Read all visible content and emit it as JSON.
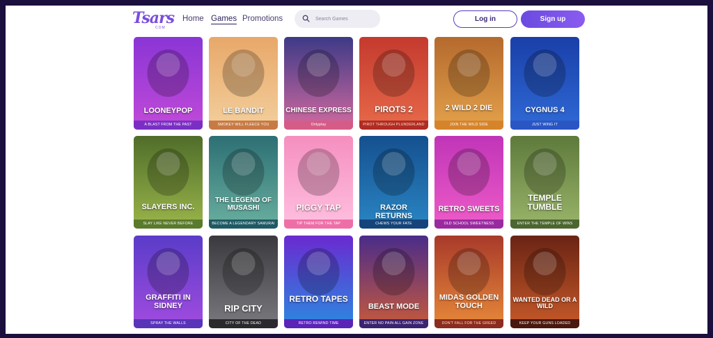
{
  "header": {
    "logo_text": "Tsars",
    "logo_sub": "COM",
    "nav": [
      {
        "label": "Home"
      },
      {
        "label": "Games"
      },
      {
        "label": "Promotions"
      }
    ],
    "search_placeholder": "Search Games",
    "login_label": "Log in",
    "signup_label": "Sign up"
  },
  "colors": {
    "accent": "#6a4ae0",
    "page_bg": "#1b0f3d"
  },
  "games": [
    {
      "title": "LOONEYPOP",
      "tagline": "A BLAST FROM THE PAST",
      "bg": "#8a35d6",
      "bg2": "#c24ad8",
      "tag_bg": "#7a2fc4",
      "tag_color": "#ffffff"
    },
    {
      "title": "LE BANDIT",
      "tagline": "SMOKEY WILL FLEECE YOU",
      "bg": "#e8a86a",
      "bg2": "#f3cf9c",
      "tag_bg": "#c87a45",
      "tag_color": "#ffffff"
    },
    {
      "title": "CHINESE EXPRESS",
      "tagline": "Onlyplay",
      "bg": "#3d3a86",
      "bg2": "#d36aa0",
      "tag_bg": "#d55c86",
      "tag_color": "#ffffff"
    },
    {
      "title": "PIROTS 2",
      "tagline": "PIROT THROUGH PLUNDERLAND",
      "bg": "#c43a2e",
      "bg2": "#e86a4a",
      "tag_bg": "#b02c24",
      "tag_color": "#ffe0c8"
    },
    {
      "title": "2 WILD 2 DIE",
      "tagline": "JOIN THE WILD SIDE",
      "bg": "#b56a2e",
      "bg2": "#e4a24a",
      "tag_bg": "#d6842c",
      "tag_color": "#ffffff"
    },
    {
      "title": "CYGNUS 4",
      "tagline": "JUST WING IT",
      "bg": "#1a3fa8",
      "bg2": "#2f6ad6",
      "tag_bg": "#2a56c4",
      "tag_color": "#ffffff"
    },
    {
      "title": "SLAYERS INC.",
      "tagline": "SLAY LIKE NEVER BEFORE",
      "bg": "#4f6d2a",
      "bg2": "#9bb64a",
      "tag_bg": "#5a7a2c",
      "tag_color": "#ffffff"
    },
    {
      "title": "THE LEGEND OF MUSASHI",
      "tagline": "BECOME A LEGENDARY SAMURAI",
      "bg": "#2d6f74",
      "bg2": "#6ab0a0",
      "tag_bg": "#1f5a64",
      "tag_color": "#ffffff"
    },
    {
      "title": "PIGGY TAP",
      "tagline": "TIP THEM FOR THE TAP",
      "bg": "#f58fc0",
      "bg2": "#ffc0e0",
      "tag_bg": "#ee6fa8",
      "tag_color": "#ffffff"
    },
    {
      "title": "RAZOR RETURNS",
      "tagline": "CHEWS YOUR FATE",
      "bg": "#15508f",
      "bg2": "#2a86c4",
      "tag_bg": "#15447a",
      "tag_color": "#ffffff"
    },
    {
      "title": "RETRO SWEETS",
      "tagline": "OLD SCHOOL SWEETNESS",
      "bg": "#c035b8",
      "bg2": "#ef5cc8",
      "tag_bg": "#9a2aa0",
      "tag_color": "#ffffff"
    },
    {
      "title": "TEMPLE TUMBLE",
      "tagline": "ENTER THE TEMPLE OF WINS",
      "bg": "#5e7a3c",
      "bg2": "#9ab56a",
      "tag_bg": "#4c6630",
      "tag_color": "#ffffff"
    },
    {
      "title": "GRAFFITI IN SIDNEY",
      "tagline": "SPRAY THE WALLS",
      "bg": "#5a3cc8",
      "bg2": "#a24ce0",
      "tag_bg": "#5a34b8",
      "tag_color": "#ffffff"
    },
    {
      "title": "RIP CITY",
      "tagline": "CITY OF THE DEAD",
      "bg": "#3a3a3e",
      "bg2": "#7a7a80",
      "tag_bg": "#2a2a2e",
      "tag_color": "#ffffff"
    },
    {
      "title": "RETRO TAPES",
      "tagline": "RETRO REWIND TIME",
      "bg": "#6a2ad0",
      "bg2": "#2a8ae0",
      "tag_bg": "#5a24b8",
      "tag_color": "#ffffff"
    },
    {
      "title": "BEAST MODE",
      "tagline": "ENTER NO PAIN ALL GAIN ZONE",
      "bg": "#4a2c8a",
      "bg2": "#c85a3a",
      "tag_bg": "#3a2470",
      "tag_color": "#ffffff"
    },
    {
      "title": "MIDAS GOLDEN TOUCH",
      "tagline": "DON'T FALL FOR THE GREED",
      "bg": "#a83a2a",
      "bg2": "#e88a3a",
      "tag_bg": "#8a2c20",
      "tag_color": "#ffe5b0"
    },
    {
      "title": "WANTED DEAD OR A WILD",
      "tagline": "KEEP YOUR GUNS LOADED",
      "bg": "#6a2414",
      "bg2": "#c85a2a",
      "tag_bg": "#4a180e",
      "tag_color": "#ffffff"
    }
  ]
}
